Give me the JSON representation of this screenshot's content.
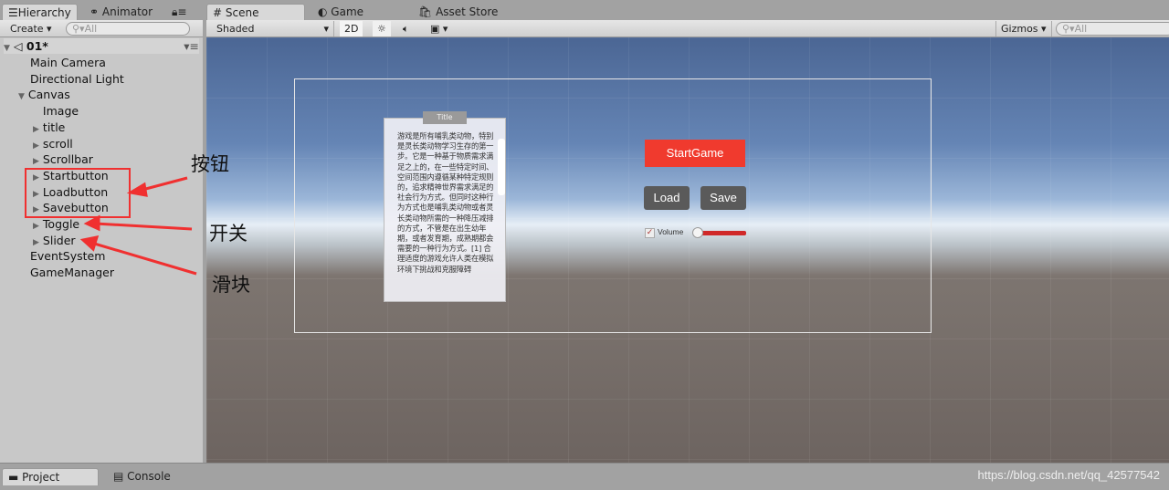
{
  "hierarchy_tabs": {
    "hierarchy": "Hierarchy",
    "animator": "Animator"
  },
  "scene_tabs": {
    "scene": "Scene",
    "game": "Game",
    "asset_store": "Asset Store"
  },
  "hierarchy_toolbar": {
    "create": "Create",
    "search_placeholder": "All"
  },
  "scene_toolbar": {
    "shading": "Shaded",
    "mode_2d": "2D",
    "gizmos": "Gizmos",
    "search_placeholder": "All"
  },
  "scene_root": "01*",
  "hierarchy_items": [
    {
      "label": "Main Camera",
      "depth": 0,
      "expandable": false
    },
    {
      "label": "Directional Light",
      "depth": 0,
      "expandable": false
    },
    {
      "label": "Canvas",
      "depth": 0,
      "expandable": true,
      "expanded": true
    },
    {
      "label": "Image",
      "depth": 1,
      "expandable": false
    },
    {
      "label": "title",
      "depth": 1,
      "expandable": true
    },
    {
      "label": "scroll",
      "depth": 1,
      "expandable": true
    },
    {
      "label": "Scrollbar",
      "depth": 1,
      "expandable": true
    },
    {
      "label": "Startbutton",
      "depth": 1,
      "expandable": true
    },
    {
      "label": "Loadbutton",
      "depth": 1,
      "expandable": true
    },
    {
      "label": "Savebutton",
      "depth": 1,
      "expandable": true
    },
    {
      "label": "Toggle",
      "depth": 1,
      "expandable": true
    },
    {
      "label": "Slider",
      "depth": 1,
      "expandable": true
    },
    {
      "label": "EventSystem",
      "depth": 0,
      "expandable": false
    },
    {
      "label": "GameManager",
      "depth": 0,
      "expandable": false
    }
  ],
  "annotations": {
    "buttons": "按钮",
    "toggle": "开关",
    "slider": "滑块",
    "color": "#f03030"
  },
  "game_ui": {
    "panel_title": "Title",
    "panel_text": "游戏是所有哺乳类动物，特别是灵长类动物学习生存的第一步。它是一种基于物质需求满足之上的，在一些特定时间、空间范围内遵循某种特定规则的，追求精神世界需求满足的社会行为方式。但同时这种行为方式也是哺乳类动物或者灵长类动物所需的一种降压减排的方式，不管是在出生幼年期，或者发育期，成熟期都会需要的一种行为方式。[1] 合理适度的游戏允许人类在模拟环境下挑战和克服障碍",
    "start_button": "StartGame",
    "start_color": "#f03a2e",
    "load_button": "Load",
    "save_button": "Save",
    "toggle_label": "Volume",
    "toggle_checked": true,
    "slider_value": 0
  },
  "bottom_tabs": {
    "project": "Project",
    "console": "Console"
  },
  "watermark": "https://blog.csdn.net/qq_42577542"
}
